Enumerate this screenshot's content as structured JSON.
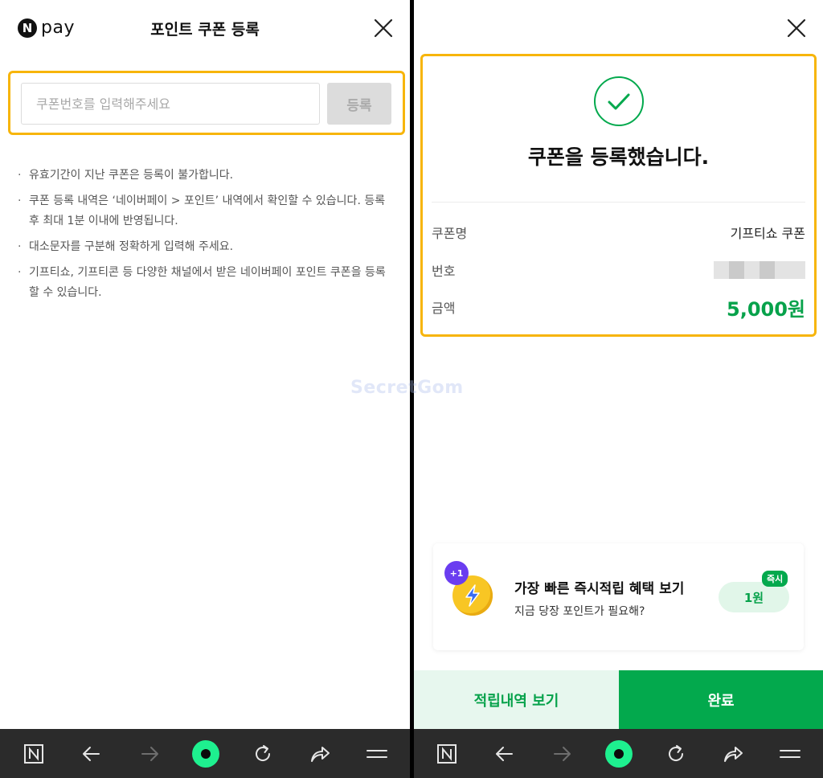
{
  "left": {
    "logo": {
      "badge": "N",
      "text": "pay"
    },
    "title": "포인트 쿠폰 등록",
    "coupon_input": {
      "placeholder": "쿠폰번호를 입력해주세요",
      "value": ""
    },
    "register_label": "등록",
    "notes": [
      "유효기간이 지난 쿠폰은 등록이 불가합니다.",
      "쿠폰 등록 내역은 ‘네이버페이 > 포인트’ 내역에서 확인할 수 있습니다. 등록 후 최대 1분 이내에 반영됩니다.",
      "대소문자를 구분해 정확하게 입력해 주세요.",
      "기프티쇼, 기프티콘 등 다양한 채널에서 받은 네이버페이 포인트 쿠폰을 등록할 수 있습니다."
    ]
  },
  "watermark": "SecretGom",
  "right": {
    "success_title": "쿠폰을 등록했습니다.",
    "info": {
      "name_label": "쿠폰명",
      "name_value": "기프티쇼 쿠폰",
      "number_label": "번호",
      "amount_label": "금액",
      "amount_value": "5,000원"
    },
    "promo": {
      "badge": "+1",
      "title": "가장 빠른 즉시적립 혜택 보기",
      "subtitle": "지금 당장 포인트가 필요해?",
      "pill": "1원",
      "tag": "즉시"
    },
    "buttons": {
      "history": "적립내역 보기",
      "done": "완료"
    }
  },
  "navbar": {
    "icons": [
      "naver-home-icon",
      "back-arrow-icon",
      "forward-arrow-icon",
      "green-dot-icon",
      "refresh-icon",
      "share-icon",
      "menu-icon"
    ]
  },
  "colors": {
    "brand_green": "#03a94d",
    "highlight": "#f7b50b",
    "navbar_bg": "#2b2b2b",
    "nav_dot": "#1ef08f"
  }
}
